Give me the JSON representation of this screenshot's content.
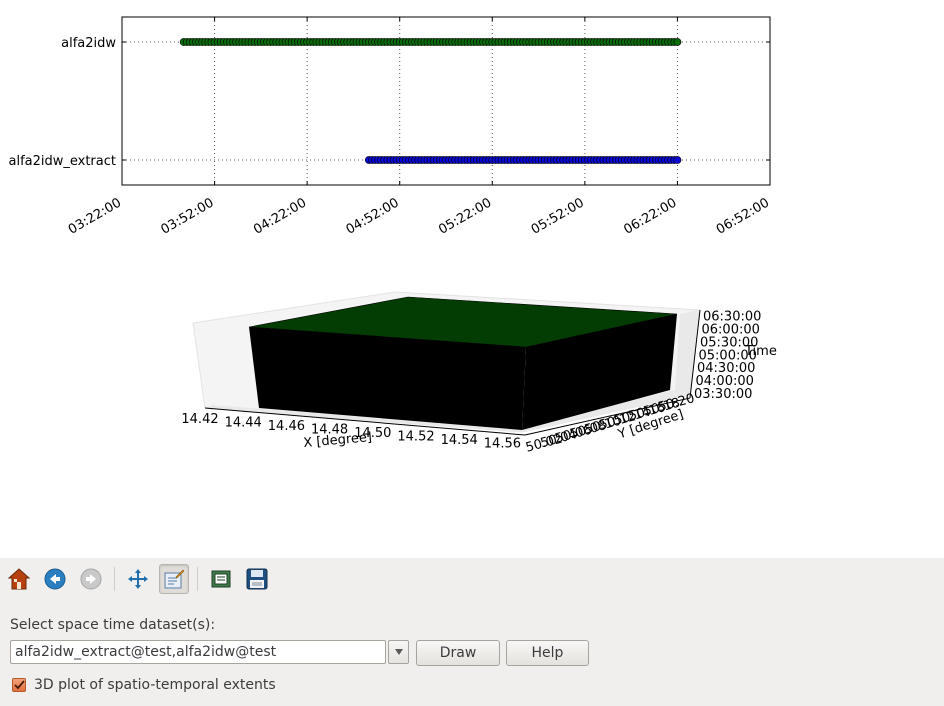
{
  "timeline_chart": {
    "type": "scatter",
    "datasets": [
      {
        "name": "alfa2idw",
        "start": "03:42:00",
        "end": "06:22:00",
        "color": "#0a6b0a"
      },
      {
        "name": "alfa2idw_extract",
        "start": "04:42:00",
        "end": "06:22:00",
        "color": "#0a0ad2"
      }
    ],
    "x_ticks": [
      "03:22:00",
      "03:52:00",
      "04:22:00",
      "04:52:00",
      "05:22:00",
      "05:52:00",
      "06:22:00",
      "06:52:00"
    ],
    "xlim": [
      "03:22:00",
      "06:52:00"
    ],
    "grid": true
  },
  "plot3d": {
    "x_label": "X [degree]",
    "y_label": "Y [degree]",
    "z_label": "Time",
    "x_ticks": [
      "14.42",
      "14.44",
      "14.46",
      "14.48",
      "14.50",
      "14.52",
      "14.54",
      "14.56"
    ],
    "y_ticks": [
      "50.02",
      "50.04",
      "50.06",
      "50.08",
      "50.10",
      "50.12",
      "50.14",
      "50.16",
      "50.18",
      "50.20"
    ],
    "z_ticks": [
      "03:30:00",
      "04:00:00",
      "04:30:00",
      "05:00:00",
      "05:30:00",
      "06:00:00",
      "06:30:00"
    ],
    "top_color": "#033d03",
    "side_color": "#000000"
  },
  "toolbar": {
    "icons": [
      "home-icon",
      "back-icon",
      "forward-icon",
      "pan-icon",
      "zoom-icon",
      "subplots-icon",
      "save-icon"
    ]
  },
  "form": {
    "select_label": "Select space time dataset(s):",
    "dataset_value": "alfa2idw_extract@test,alfa2idw@test",
    "draw_label": "Draw",
    "help_label": "Help",
    "checkbox_label": "3D plot of spatio-temporal extents",
    "checkbox_checked": true
  },
  "colors": {
    "accent": "#e2703d",
    "panel_bg": "#f0efed"
  }
}
